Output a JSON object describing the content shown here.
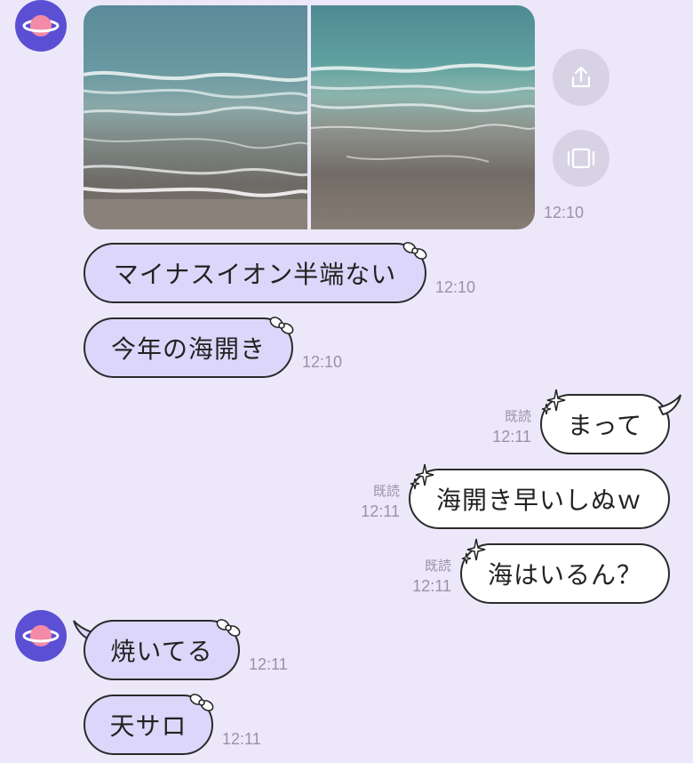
{
  "contact": {
    "avatar_icon": "planet-icon",
    "avatar_colors": {
      "bg": "#5b4fd4",
      "planet": "#f28aa8",
      "ring": "#ffffff"
    }
  },
  "photos": {
    "left": {
      "icon": "beach-waves-photo"
    },
    "right": {
      "icon": "beach-waves-photo"
    },
    "time": "12:10"
  },
  "actions": {
    "share_icon": "share-icon",
    "slideshow_icon": "slideshow-icon"
  },
  "messages": [
    {
      "side": "left",
      "text": "マイナスイオン半端ない",
      "time": "12:10"
    },
    {
      "side": "left",
      "text": "今年の海開き",
      "time": "12:10"
    },
    {
      "side": "right",
      "text": "まって",
      "read": "既読",
      "time": "12:11"
    },
    {
      "side": "right",
      "text": "海開き早いしぬｗ",
      "read": "既読",
      "time": "12:11"
    },
    {
      "side": "right",
      "text": "海はいるん？",
      "read": "既読",
      "time": "12:11"
    },
    {
      "side": "left",
      "text": "焼いてる",
      "time": "12:11"
    },
    {
      "side": "left",
      "text": "天サロ",
      "time": "12:11"
    }
  ],
  "colors": {
    "background": "#ece8fa",
    "incoming_bubble": "#ddd6fb",
    "outgoing_bubble": "#ffffff",
    "timestamp": "#9991aa"
  }
}
